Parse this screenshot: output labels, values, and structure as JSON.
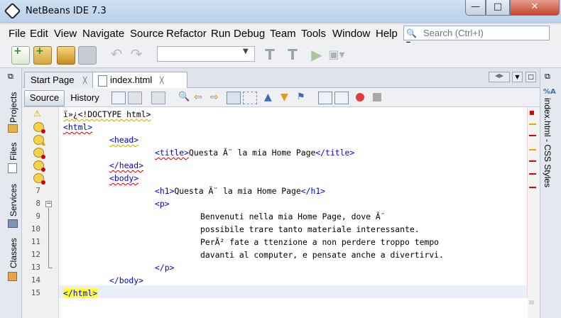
{
  "window": {
    "title": "NetBeans IDE 7.3"
  },
  "menu": [
    "File",
    "Edit",
    "View",
    "Navigate",
    "Source",
    "Refactor",
    "Run",
    "Debug",
    "Team",
    "Tools",
    "Window",
    "Help"
  ],
  "search": {
    "placeholder": "Search (Ctrl+I)"
  },
  "left_panels": [
    "Projects",
    "Files",
    "Services",
    "Classes"
  ],
  "right_panel": "index.html - CSS Styles",
  "tabs": [
    {
      "label": "Start Page",
      "active": false
    },
    {
      "label": "index.html",
      "active": true
    }
  ],
  "editor_toolbar": {
    "source": "Source",
    "history": "History"
  },
  "code": {
    "line_numbers": [
      "7",
      "8",
      "9",
      "10",
      "11",
      "12",
      "13",
      "14",
      "15"
    ],
    "lines": {
      "l1": "ï»¿<!DOCTYPE html>",
      "l2": "<html>",
      "l3": "<head>",
      "l4_tag_open": "<title>",
      "l4_text": "Questa Ã¨ la mia Home Page",
      "l4_tag_close": "</title>",
      "l5": "</head>",
      "l6": "<body>",
      "l7_tag_open": "<h1>",
      "l7_text": "Questa Ã¨ la mia Home Page",
      "l7_tag_close": "</h1>",
      "l8": "<p>",
      "l9": "Benvenuti nella mia Home Page, dove Ã¨",
      "l10": "possibile trare tanto materiale interessante.",
      "l11": "PerÃ² fate a ttenzione a non perdere troppo tempo",
      "l12": "davanti al computer, e pensate anche a divertirvi.",
      "l13": "</p>",
      "l14": "</body>",
      "l15": "</html>"
    }
  },
  "colors": {
    "tag": "#0000e6",
    "error": "#d40000",
    "warning": "#e8a800",
    "match_highlight": "#ffff33"
  }
}
